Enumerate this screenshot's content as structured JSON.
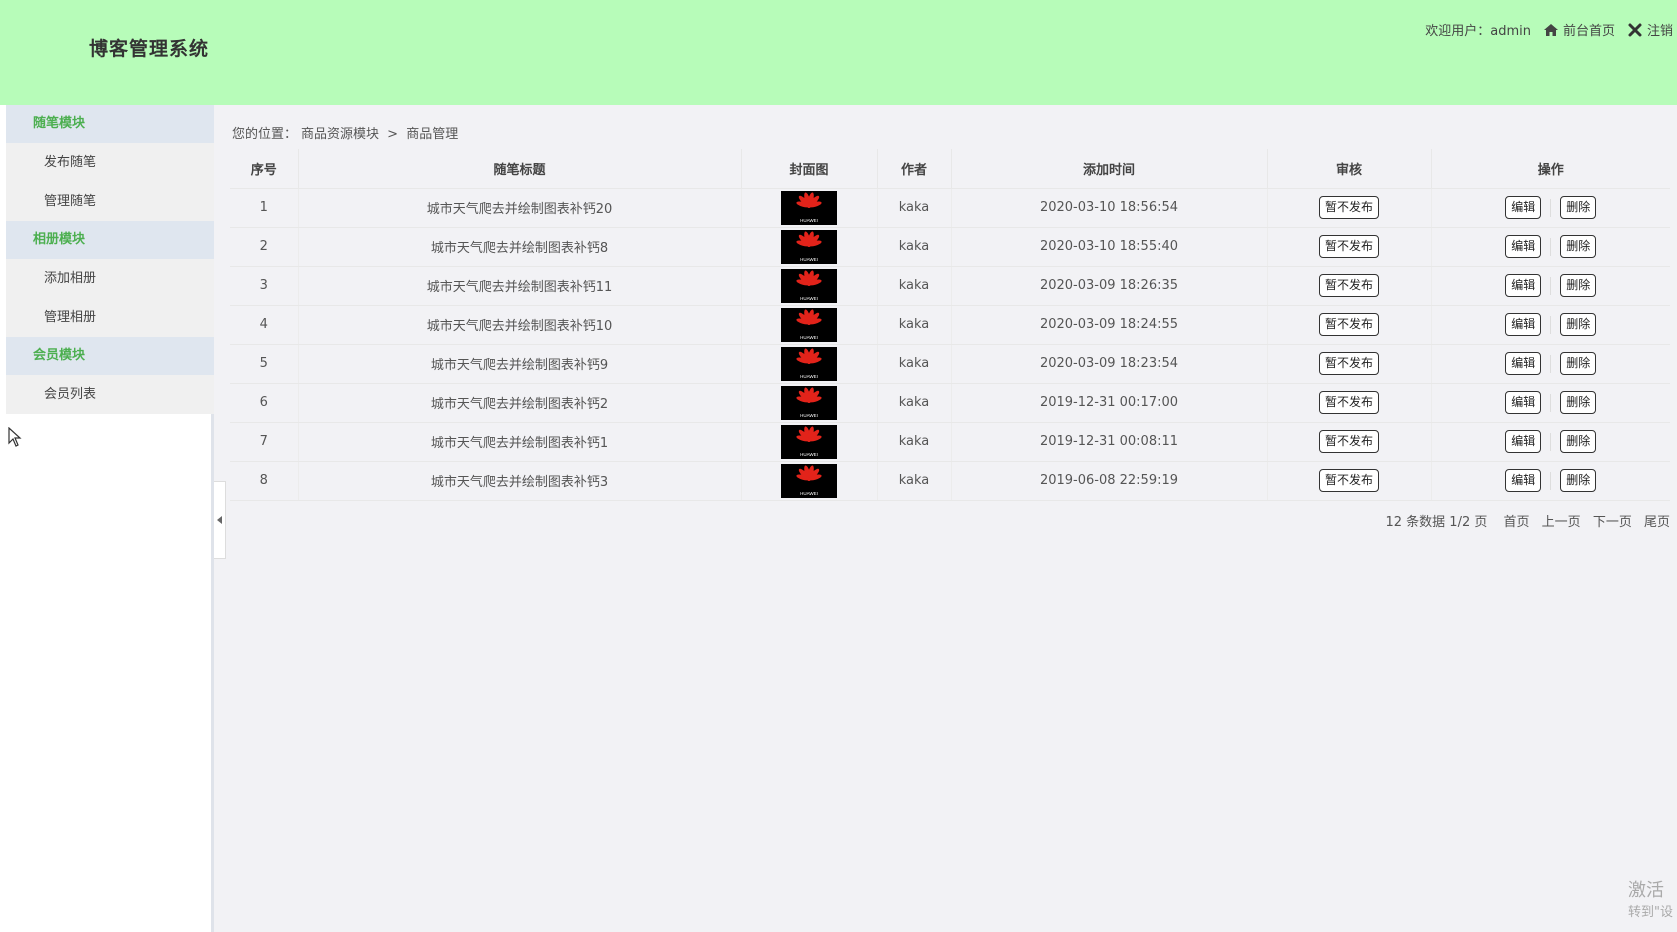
{
  "header": {
    "brand": "博客管理系统",
    "welcome": "欢迎用户：admin",
    "home_link": "前台首页",
    "logout_link": "注销",
    "bg_color": "#b7fcb9"
  },
  "sidebar": {
    "modules": [
      {
        "title": "随笔模块",
        "items": [
          "发布随笔",
          "管理随笔"
        ]
      },
      {
        "title": "相册模块",
        "items": [
          "添加相册",
          "管理相册"
        ]
      },
      {
        "title": "会员模块",
        "items": [
          "会员列表"
        ]
      }
    ],
    "accent_color": "#4caf50"
  },
  "breadcrumb": {
    "prefix": "您的位置：",
    "level1": "商品资源模块",
    "separator": ">",
    "level2": "商品管理"
  },
  "table": {
    "columns": [
      "序号",
      "随笔标题",
      "封面图",
      "作者",
      "添加时间",
      "审核",
      "操作"
    ],
    "rows": [
      {
        "no": "1",
        "title": "城市天气爬去并绘制图表补钙20",
        "author": "kaka",
        "time": "2020-03-10 18:56:54"
      },
      {
        "no": "2",
        "title": "城市天气爬去并绘制图表补钙8",
        "author": "kaka",
        "time": "2020-03-10 18:55:40"
      },
      {
        "no": "3",
        "title": "城市天气爬去并绘制图表补钙11",
        "author": "kaka",
        "time": "2020-03-09 18:26:35"
      },
      {
        "no": "4",
        "title": "城市天气爬去并绘制图表补钙10",
        "author": "kaka",
        "time": "2020-03-09 18:24:55"
      },
      {
        "no": "5",
        "title": "城市天气爬去并绘制图表补钙9",
        "author": "kaka",
        "time": "2020-03-09 18:23:54"
      },
      {
        "no": "6",
        "title": "城市天气爬去并绘制图表补钙2",
        "author": "kaka",
        "time": "2019-12-31 00:17:00"
      },
      {
        "no": "7",
        "title": "城市天气爬去并绘制图表补钙1",
        "author": "kaka",
        "time": "2019-12-31 00:08:11"
      },
      {
        "no": "8",
        "title": "城市天气爬去并绘制图表补钙3",
        "author": "kaka",
        "time": "2019-06-08 22:59:19"
      }
    ],
    "audit_label": "暂不发布",
    "edit_label": "编辑",
    "delete_label": "删除",
    "cover_logo_text": "HUAWEI"
  },
  "pager": {
    "info": "12 条数据 1/2 页",
    "first": "首页",
    "prev": "上一页",
    "next": "下一页",
    "last": "尾页"
  },
  "watermark": {
    "line1": "激活",
    "line2": "转到\"设"
  }
}
